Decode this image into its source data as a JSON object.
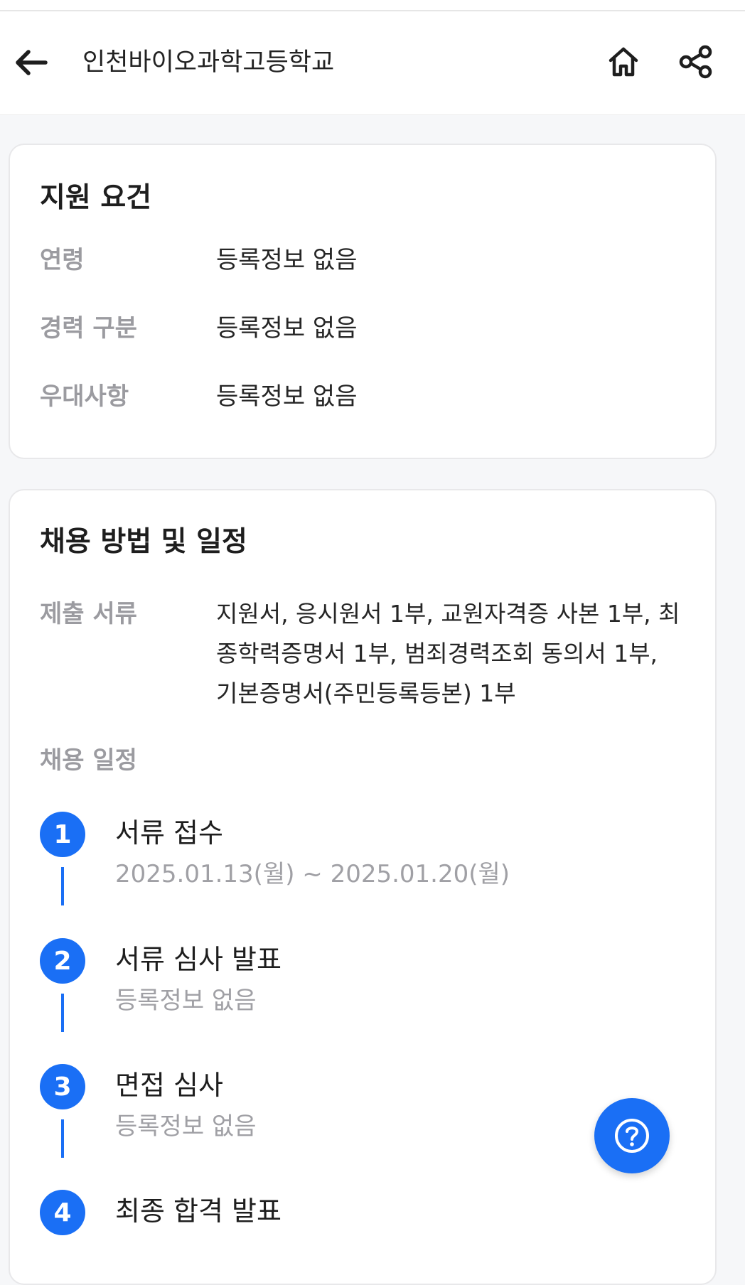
{
  "header": {
    "title": "인천바이오과학고등학교",
    "back_icon": "arrow-left-icon",
    "home_icon": "home-icon",
    "share_icon": "share-icon"
  },
  "requirements": {
    "title": "지원 요건",
    "rows": [
      {
        "label": "연령",
        "value": "등록정보 없음"
      },
      {
        "label": "경력 구분",
        "value": "등록정보 없음"
      },
      {
        "label": "우대사항",
        "value": "등록정보 없음"
      }
    ]
  },
  "hiring": {
    "title": "채용 방법 및 일정",
    "documents_label": "제출 서류",
    "documents_lines": [
      "지원서, 응시원서 1부, 교원자격증 사본 1부, 최",
      "종학력증명서 1부, 범죄경력조회 동의서 1부,",
      "기본증명서(주민등록등본) 1부"
    ],
    "schedule_label": "채용 일정",
    "steps": [
      {
        "number": "1",
        "title": "서류 접수",
        "date": "2025.01.13(월) ~ 2025.01.20(월)"
      },
      {
        "number": "2",
        "title": "서류 심사 발표",
        "date": "등록정보 없음"
      },
      {
        "number": "3",
        "title": "면접 심사",
        "date": "등록정보 없음"
      },
      {
        "number": "4",
        "title": "최종 합격 발표",
        "date": ""
      }
    ]
  },
  "fab": {
    "icon": "help-icon"
  },
  "colors": {
    "accent": "#1a6ff5",
    "label_gray": "#9b9ba0",
    "background": "#f6f7f9"
  }
}
